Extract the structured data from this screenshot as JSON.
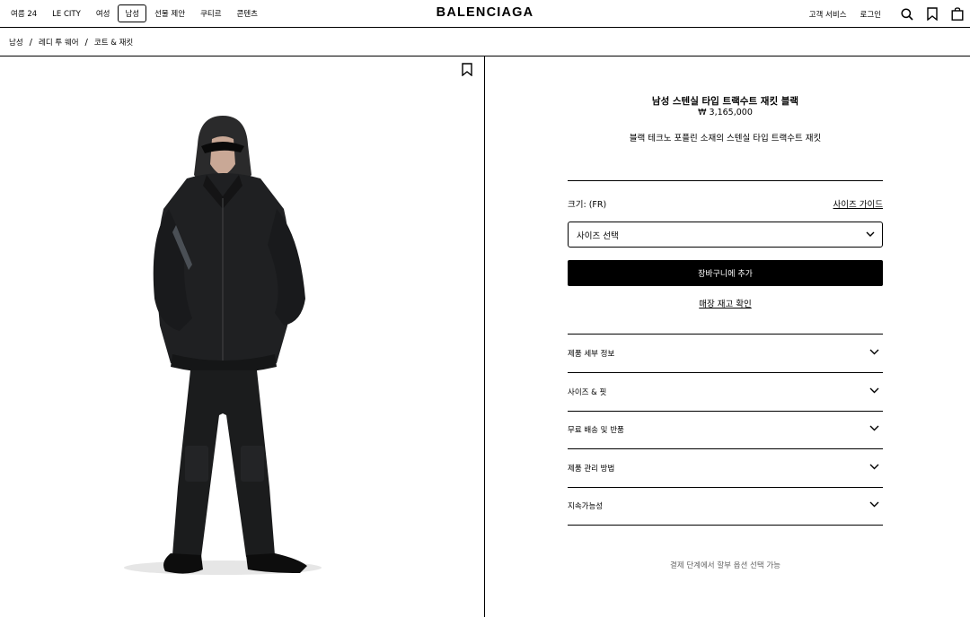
{
  "header": {
    "nav": [
      "여름 24",
      "LE CITY",
      "여성",
      "남성",
      "선물 제안",
      "쿠티르",
      "콘텐츠"
    ],
    "active_nav": "남성",
    "logo": "BALENCIAGA",
    "customer_service": "고객 서비스",
    "login": "로그인",
    "icons": [
      "search-icon",
      "bookmark-icon",
      "bag-icon"
    ]
  },
  "breadcrumb": [
    "남성",
    "레디 투 웨어",
    "코트 & 재킷"
  ],
  "breadcrumb_separator": "/",
  "product": {
    "name": "남성 스텐실 타입 트랙수트 재킷 블랙",
    "price": "₩ 3,165,000",
    "description": "블랙 테크노 포플린 소재의 스텐실 타입 트랙수트 재킷",
    "size_label": "크기: (FR)",
    "size_guide": "사이즈 가이드",
    "size_select_placeholder": "사이즈 선택",
    "add_to_cart": "장바구니에 추가",
    "stock_check": "매장 재고 확인",
    "accordions": [
      "제품 세부 정보",
      "사이즈 & 핏",
      "무료 배송 및 반품",
      "제품 관리 방법",
      "지속가능성"
    ],
    "installment_note": "결제 단계에서 할부 옵션 선택 가능"
  },
  "colors": {
    "primary": "#000000",
    "background": "#ffffff",
    "muted": "#666666"
  }
}
